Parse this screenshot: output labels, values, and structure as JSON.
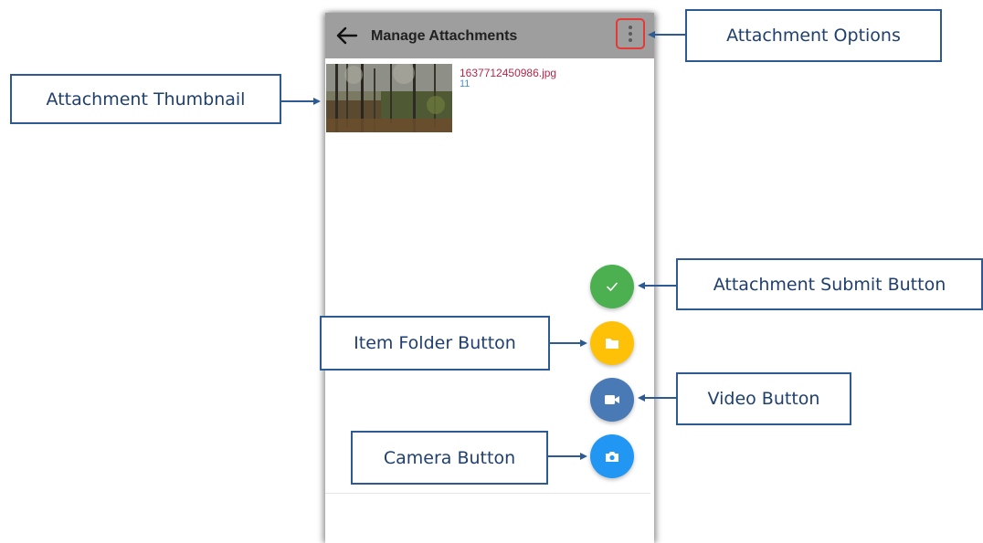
{
  "app": {
    "title": "Manage Attachments"
  },
  "attachment": {
    "file_name": "1637712450986.jpg",
    "meta": "11"
  },
  "fab_colors": {
    "submit": "#4caf50",
    "folder": "#ffc107",
    "video": "#4a7ab5",
    "camera": "#2196f3"
  },
  "callouts": {
    "thumbnail": "Attachment Thumbnail",
    "options": "Attachment Options",
    "submit": "Attachment Submit Button",
    "folder": "Item Folder Button",
    "video": "Video Button",
    "camera": "Camera Button"
  },
  "icons": {
    "back": "arrow-left-icon",
    "options": "more-vertical-icon",
    "submit": "check-icon",
    "folder": "folder-icon",
    "video": "video-camera-icon",
    "camera": "camera-icon"
  }
}
